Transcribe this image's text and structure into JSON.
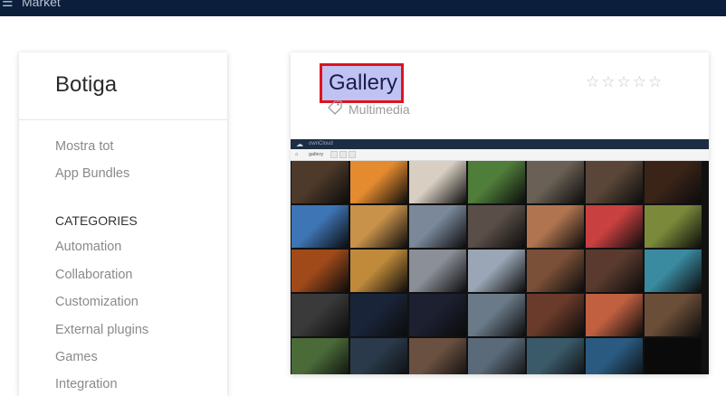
{
  "topbar": {
    "menu_icon": "hamburger-icon",
    "title": "Market"
  },
  "sidebar": {
    "store_title": "Botiga",
    "items": [
      {
        "label": "Mostra tot"
      },
      {
        "label": "App Bundles"
      }
    ],
    "categories_heading": "CATEGORIES",
    "categories": [
      {
        "label": "Automation"
      },
      {
        "label": "Collaboration"
      },
      {
        "label": "Customization"
      },
      {
        "label": "External plugins"
      },
      {
        "label": "Games"
      },
      {
        "label": "Integration"
      }
    ]
  },
  "app": {
    "title": "Gallery",
    "category": "Multimedia",
    "tag_icon": "tag-icon",
    "rating_stars": 0,
    "rating_max": 5,
    "colors": {
      "highlight_fill": "#bfc3f4",
      "highlight_border": "#e0131a"
    },
    "screenshot": {
      "topbar_label": "ownCloud",
      "crumb_label": "gallery",
      "icons": [
        "cloud-icon",
        "home-icon"
      ],
      "palette": [
        [
          "#4e3a2a",
          "#e48b2f",
          "#d8cfc2",
          "#4f7d3a",
          "#6a6055",
          "#5a4638",
          "#3a2418"
        ],
        [
          "#3e75b5",
          "#c8924a",
          "#7a8899",
          "#5a4e48",
          "#b07550",
          "#c94040",
          "#7a8a3a"
        ],
        [
          "#a04a1a",
          "#c08a3a",
          "#8a8f98",
          "#9aa6b5",
          "#7a5038",
          "#5a3a2e",
          "#3a8aa0"
        ],
        [
          "#3a3a3a",
          "#1a2438",
          "#1c2030",
          "#6a7a88",
          "#6a3a2a",
          "#c06040",
          "#6b4e38"
        ],
        [
          "#4a6a38",
          "#2a3a4a",
          "#6a5040",
          "#5a6a78",
          "#3a5a6a",
          "#2a5a80",
          "#0a0a0a"
        ]
      ]
    }
  }
}
